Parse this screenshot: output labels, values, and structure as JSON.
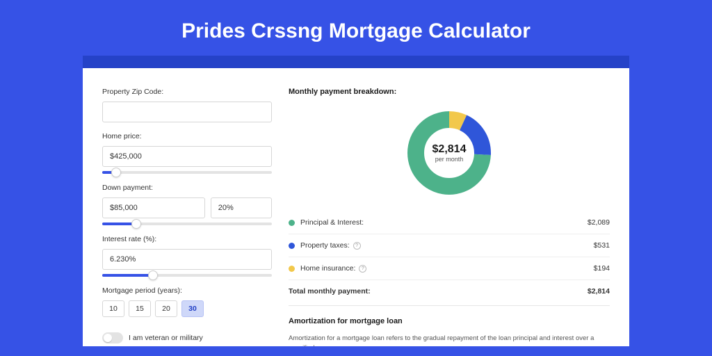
{
  "page_title": "Prides Crssng Mortgage Calculator",
  "form": {
    "zip": {
      "label": "Property Zip Code:",
      "value": ""
    },
    "home_price": {
      "label": "Home price:",
      "value": "$425,000",
      "slider_pct": 8
    },
    "down_payment": {
      "label": "Down payment:",
      "amount": "$85,000",
      "percent": "20%",
      "slider_pct": 20
    },
    "interest": {
      "label": "Interest rate (%):",
      "value": "6.230%",
      "slider_pct": 30
    },
    "period": {
      "label": "Mortgage period (years):",
      "options": [
        "10",
        "15",
        "20",
        "30"
      ],
      "selected": "30"
    },
    "veteran": {
      "label": "I am veteran or military",
      "checked": false
    }
  },
  "breakdown": {
    "title": "Monthly payment breakdown:",
    "center_value": "$2,814",
    "center_sub": "per month",
    "items": [
      {
        "label": "Principal & Interest:",
        "value": "$2,089",
        "color": "#4DB28A",
        "info": false
      },
      {
        "label": "Property taxes:",
        "value": "$531",
        "color": "#2F56D9",
        "info": true
      },
      {
        "label": "Home insurance:",
        "value": "$194",
        "color": "#F2C84B",
        "info": true
      }
    ],
    "total": {
      "label": "Total monthly payment:",
      "value": "$2,814"
    }
  },
  "chart_data": {
    "type": "pie",
    "title": "Monthly payment breakdown",
    "series": [
      {
        "name": "Principal & Interest",
        "value": 2089,
        "color": "#4DB28A"
      },
      {
        "name": "Property taxes",
        "value": 531,
        "color": "#2F56D9"
      },
      {
        "name": "Home insurance",
        "value": 194,
        "color": "#F2C84B"
      }
    ],
    "total": 2814
  },
  "amortization": {
    "title": "Amortization for mortgage loan",
    "body": "Amortization for a mortgage loan refers to the gradual repayment of the loan principal and interest over a specified"
  }
}
